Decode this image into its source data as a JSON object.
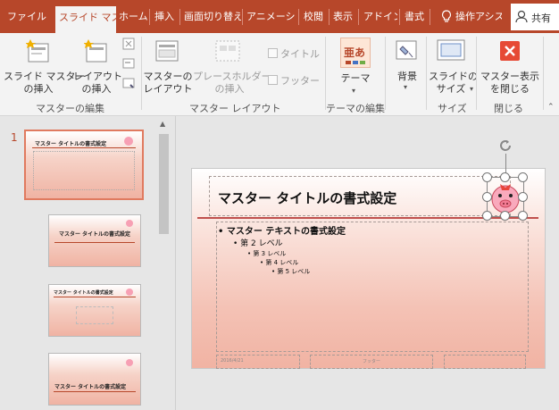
{
  "tabs": [
    {
      "label": "ファイル"
    },
    {
      "label": "スライド マスター"
    },
    {
      "label": "ホーム"
    },
    {
      "label": "挿入"
    },
    {
      "label": "画面切り替え"
    },
    {
      "label": "アニメーション"
    },
    {
      "label": "校閲"
    },
    {
      "label": "表示"
    },
    {
      "label": "アドイン"
    },
    {
      "label": "書式"
    }
  ],
  "tell_me": "操作アシスト",
  "share": "共有",
  "ribbon": {
    "btn_insert_master": "スライド マスター\nの挿入",
    "btn_insert_layout": "レイアウト\nの挿入",
    "btn_master_layout": "マスターの\nレイアウト",
    "btn_placeholder": "プレースホルダー\nの挿入",
    "chk_title": "タイトル",
    "chk_footer": "フッター",
    "btn_theme": "テーマ",
    "btn_background": "背景",
    "btn_slide_size": "スライドの\nサイズ",
    "btn_close": "マスター表示\nを閉じる",
    "group_edit_master": "マスターの編集",
    "group_master_layout": "マスター レイアウト",
    "group_edit_theme": "テーマの編集",
    "group_size": "サイズ",
    "group_close": "閉じる"
  },
  "thumbs": {
    "number": "1",
    "t1_title": "マスター タイトルの書式設定",
    "t2_title": "マスター タイトルの書式設定",
    "t3_title": "マスター タイトルの書式設定",
    "t4_title": "マスター タイトルの書式設定"
  },
  "slide": {
    "title": "マスター タイトルの書式設定",
    "l1": "• マスター テキストの書式設定",
    "l2": "• 第 2 レベル",
    "l3": "• 第 3 レベル",
    "l4": "• 第 4 レベル",
    "l5": "• 第 5 レベル",
    "date": "2016/4/21",
    "footer": "フッター"
  },
  "colors": {
    "accent": "#b7472a",
    "close": "#e64a35"
  }
}
